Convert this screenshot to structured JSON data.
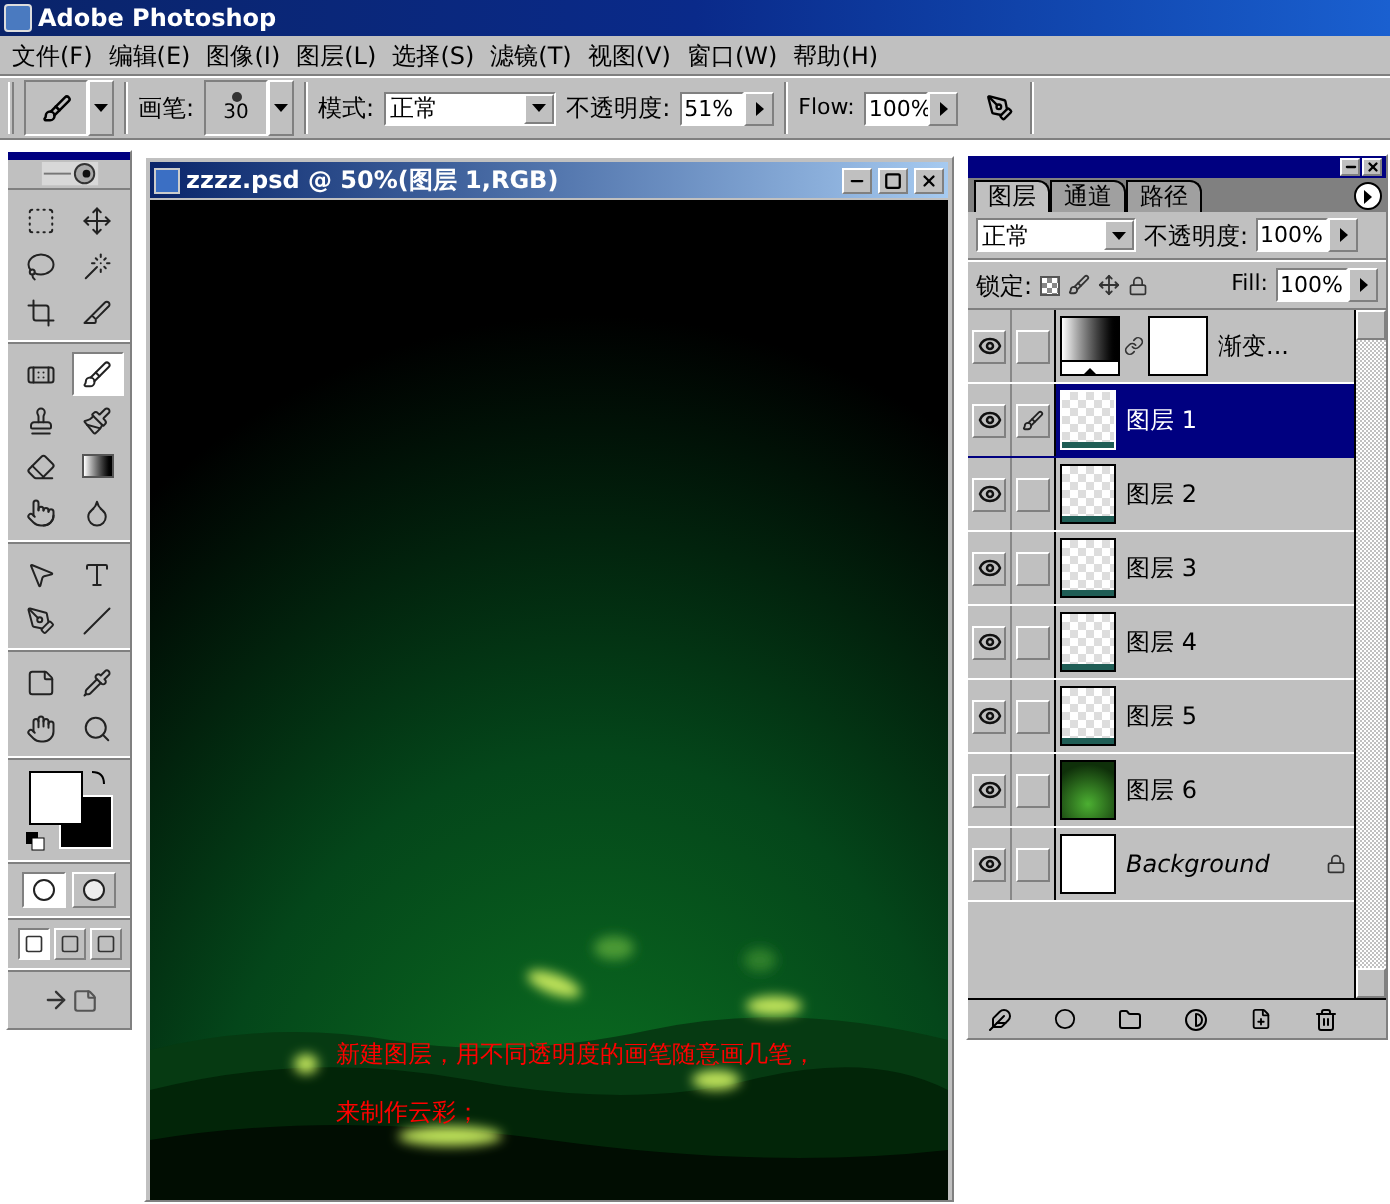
{
  "app_title": "Adobe Photoshop",
  "menu": [
    "文件(F)",
    "编辑(E)",
    "图像(I)",
    "图层(L)",
    "选择(S)",
    "滤镜(T)",
    "视图(V)",
    "窗口(W)",
    "帮助(H)"
  ],
  "options_bar": {
    "brush_label": "画笔:",
    "brush_size": "30",
    "mode_label": "模式:",
    "mode_value": "正常",
    "opacity_label": "不透明度:",
    "opacity_value": "51%",
    "flow_label": "Flow:",
    "flow_value": "100%"
  },
  "toolbox": {
    "tool_groups": [
      [
        {
          "kind": "marquee",
          "selected": false
        },
        {
          "kind": "move",
          "selected": false
        },
        {
          "kind": "lasso",
          "selected": false
        },
        {
          "kind": "wand",
          "selected": false
        },
        {
          "kind": "crop",
          "selected": false
        },
        {
          "kind": "slice",
          "selected": false
        }
      ],
      [
        {
          "kind": "heal",
          "selected": false
        },
        {
          "kind": "brush",
          "selected": true
        },
        {
          "kind": "stamp",
          "selected": false
        },
        {
          "kind": "history",
          "selected": false
        },
        {
          "kind": "eraser",
          "selected": false
        },
        {
          "kind": "gradient",
          "selected": false
        },
        {
          "kind": "smudge",
          "selected": false
        },
        {
          "kind": "dodge",
          "selected": false
        }
      ],
      [
        {
          "kind": "select",
          "selected": false
        },
        {
          "kind": "type",
          "selected": false
        },
        {
          "kind": "pen",
          "selected": false
        },
        {
          "kind": "line",
          "selected": false
        }
      ],
      [
        {
          "kind": "notes",
          "selected": false
        },
        {
          "kind": "eyedropper",
          "selected": false
        },
        {
          "kind": "hand",
          "selected": false
        },
        {
          "kind": "zoom",
          "selected": false
        }
      ]
    ],
    "mask_modes": [
      {
        "selected": true
      },
      {
        "selected": false
      }
    ],
    "screen_modes": [
      {
        "selected": true
      },
      {
        "selected": false
      },
      {
        "selected": false
      }
    ]
  },
  "document": {
    "title": "zzzz.psd @ 50%(图层 1,RGB)",
    "annotation": [
      "新建图层，用不同透明度的画笔随意画几笔，",
      "来制作云彩；"
    ]
  },
  "layers_panel": {
    "tabs": [
      {
        "label": "图层",
        "selected": true
      },
      {
        "label": "通道",
        "selected": false
      },
      {
        "label": "路径",
        "selected": false
      }
    ],
    "blend_mode": "正常",
    "opacity_label": "不透明度:",
    "opacity_value": "100%",
    "lock_label": "锁定:",
    "fill_label": "Fill:",
    "fill_value": "100%",
    "layers": [
      {
        "kind": "adjustment",
        "name": "渐变...",
        "visible": true,
        "editing": false,
        "selected": false
      },
      {
        "kind": "transparent",
        "name": "图层 1",
        "visible": true,
        "editing": true,
        "selected": true
      },
      {
        "kind": "transparent",
        "name": "图层 2",
        "visible": true,
        "editing": false,
        "selected": false
      },
      {
        "kind": "transparent",
        "name": "图层 3",
        "visible": true,
        "editing": false,
        "selected": false
      },
      {
        "kind": "transparent",
        "name": "图层 4",
        "visible": true,
        "editing": false,
        "selected": false
      },
      {
        "kind": "transparent",
        "name": "图层 5",
        "visible": true,
        "editing": false,
        "selected": false
      },
      {
        "kind": "gradient",
        "name": "图层 6",
        "visible": true,
        "editing": false,
        "selected": false
      },
      {
        "kind": "background",
        "name": "Background",
        "visible": true,
        "editing": false,
        "selected": false
      }
    ]
  }
}
